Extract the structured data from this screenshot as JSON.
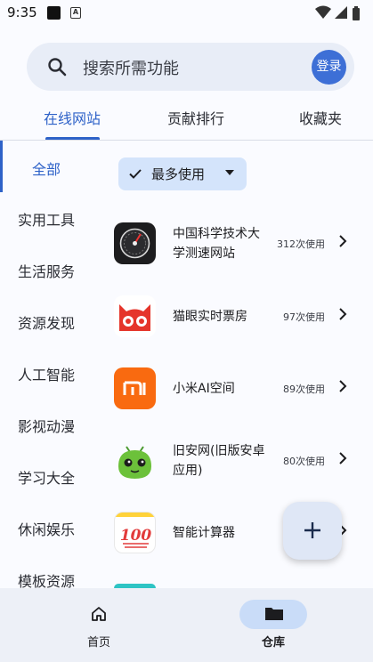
{
  "status_bar": {
    "time": "9:35",
    "a_glyph": "A"
  },
  "search": {
    "placeholder": "搜索所需功能",
    "login_label": "登录"
  },
  "tabs": [
    {
      "label": "在线网站",
      "active": true
    },
    {
      "label": "贡献排行",
      "active": false
    },
    {
      "label": "收藏夹",
      "active": false
    }
  ],
  "sidebar": {
    "items": [
      {
        "label": "全部",
        "active": true
      },
      {
        "label": "实用工具"
      },
      {
        "label": "生活服务"
      },
      {
        "label": "资源发现"
      },
      {
        "label": "人工智能"
      },
      {
        "label": "影视动漫"
      },
      {
        "label": "学习大全"
      },
      {
        "label": "休闲娱乐"
      },
      {
        "label": "模板资源"
      }
    ]
  },
  "filter": {
    "label": "最多使用"
  },
  "list": [
    {
      "name": "中国科学技术大学测速网站",
      "count": "312次使用",
      "icon": "speedometer-icon"
    },
    {
      "name": "猫眼实时票房",
      "count": "97次使用",
      "icon": "cat-eye-icon"
    },
    {
      "name": "小米AI空间",
      "count": "89次使用",
      "icon": "xiaomi-icon"
    },
    {
      "name": "旧安网(旧版安卓应用)",
      "count": "80次使用",
      "icon": "android-icon"
    },
    {
      "name": "智能计算器",
      "count": "",
      "icon": "calculator-100-icon",
      "icon_text": "100"
    }
  ],
  "bottom_nav": [
    {
      "label": "首页",
      "icon": "home-icon",
      "active": false
    },
    {
      "label": "仓库",
      "icon": "folder-icon",
      "active": true
    }
  ],
  "colors": {
    "accent": "#2e62c8",
    "login": "#3d6fd6",
    "chip": "#d4e4fb"
  }
}
